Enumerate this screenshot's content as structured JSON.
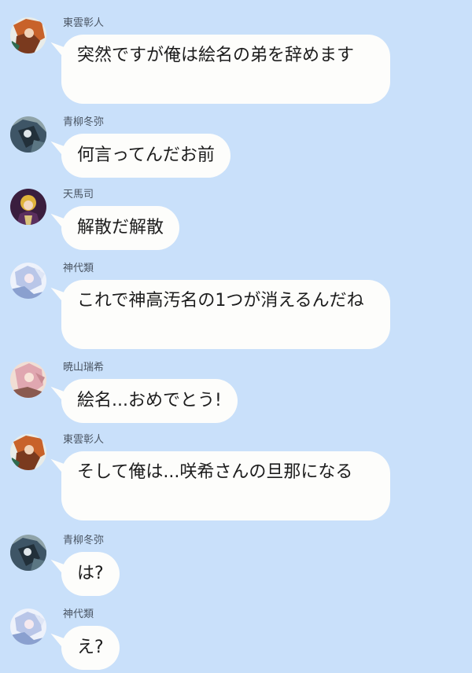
{
  "messages": [
    {
      "name": "東雲彰人",
      "avatar": "akito-avatar",
      "text": "突然ですが俺は絵名の弟を辞めます",
      "accent": "#c8622a"
    },
    {
      "name": "青柳冬弥",
      "avatar": "toya-avatar",
      "text": "何言ってんだお前",
      "accent": "#3e5566"
    },
    {
      "name": "天馬司",
      "avatar": "tsukasa-avatar",
      "text": "解散だ解散",
      "accent": "#e0b33a"
    },
    {
      "name": "神代類",
      "avatar": "rui-avatar",
      "text": "これで神高汚名の1つが消えるんだね",
      "accent": "#b9c6e8"
    },
    {
      "name": "暁山瑞希",
      "avatar": "mizuki-avatar",
      "text": "絵名...おめでとう!",
      "accent": "#e0a7b0"
    },
    {
      "name": "東雲彰人",
      "avatar": "akito-avatar",
      "text": "そして俺は...咲希さんの旦那になる",
      "accent": "#c8622a"
    },
    {
      "name": "青柳冬弥",
      "avatar": "toya-avatar",
      "text": "は?",
      "accent": "#3e5566"
    },
    {
      "name": "神代類",
      "avatar": "rui-avatar",
      "text": "え?",
      "accent": "#b9c6e8"
    }
  ],
  "colors": {
    "background": "#c9e0fa",
    "bubble": "#fdfdfb",
    "text": "#1c1c1c",
    "name_text": "#4a5563"
  }
}
